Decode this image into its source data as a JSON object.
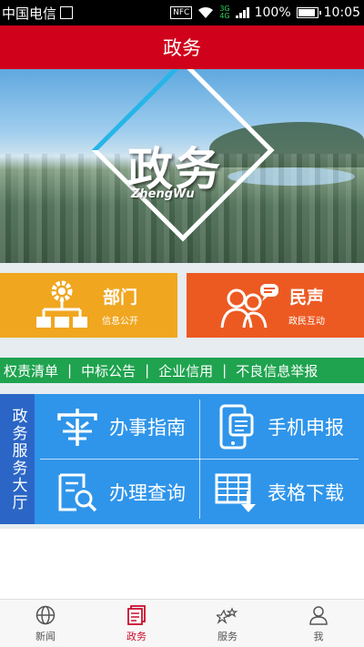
{
  "status_bar": {
    "carrier": "中国电信",
    "nfc": "NFC",
    "network_top": "3G",
    "network_bottom": "4G",
    "battery": "100%",
    "battery_level": 1.0,
    "time": "10:05"
  },
  "header": {
    "title": "政务"
  },
  "banner": {
    "title": "政务",
    "subtitle": "ZhengWu"
  },
  "tiles": [
    {
      "main": "部门",
      "sub": "信息公开",
      "color": "#f0a61f",
      "icon": "org-chart-gear-icon"
    },
    {
      "main": "民声",
      "sub": "政民互动",
      "color": "#ec5a22",
      "icon": "people-chat-icon"
    }
  ],
  "marquee": {
    "items": [
      "权责清单",
      "中标公告",
      "企业信用",
      "不良信息举报"
    ],
    "separator": "|"
  },
  "service_hall": {
    "label": "政务服务大厅",
    "items": [
      {
        "label": "办事指南",
        "icon": "guide-seal-icon"
      },
      {
        "label": "手机申报",
        "icon": "mobile-form-icon"
      },
      {
        "label": "办理查询",
        "icon": "document-search-icon"
      },
      {
        "label": "表格下载",
        "icon": "table-download-icon"
      }
    ]
  },
  "tabbar": {
    "tabs": [
      {
        "label": "新闻",
        "icon": "globe-icon",
        "active": false
      },
      {
        "label": "政务",
        "icon": "document-stack-icon",
        "active": true
      },
      {
        "label": "服务",
        "icon": "stars-service-icon",
        "active": false
      },
      {
        "label": "我",
        "icon": "user-icon",
        "active": false
      }
    ]
  },
  "colors": {
    "header": "#d0021b",
    "active_tab": "#c8102e",
    "hall": "#2f95ea",
    "hall_label": "#2b66c6",
    "marquee": "#1fa34f"
  }
}
